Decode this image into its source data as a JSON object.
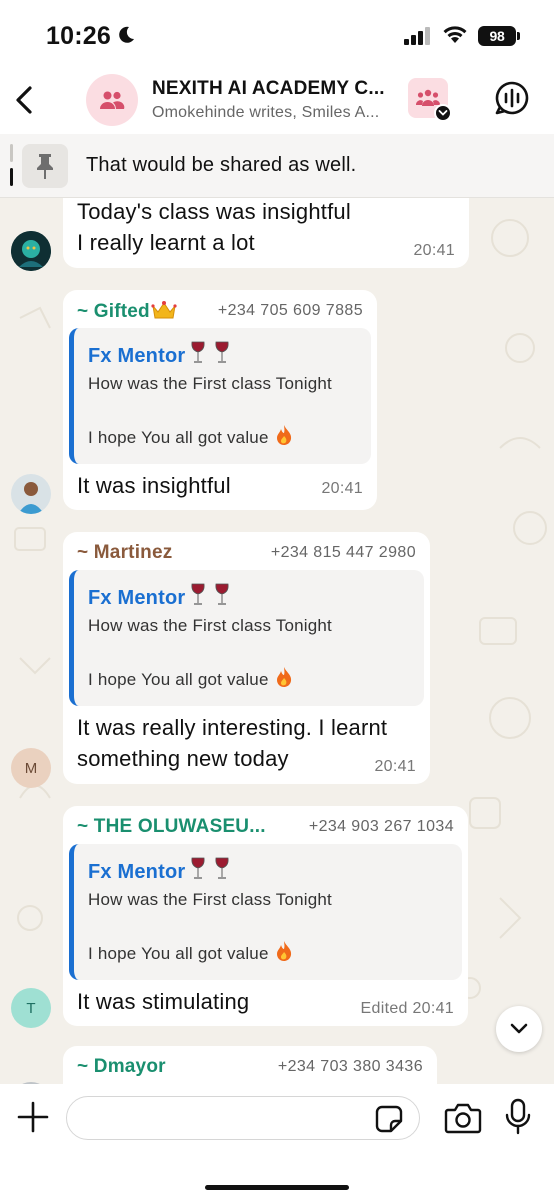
{
  "status_bar": {
    "time": "10:26",
    "battery": "98"
  },
  "header": {
    "title": "NEXITH AI ACADEMY C...",
    "subtitle": "Omokehinde writes, Smiles A..."
  },
  "pinned": {
    "text": "That would be shared as well."
  },
  "messages": [
    {
      "lines": [
        "Today's class was insightful",
        "I really learnt a lot"
      ],
      "time": "20:41"
    },
    {
      "sender": "~ Gifted",
      "sender_emoji": "crown-emoji",
      "phone": "+234 705 609 7885",
      "quote": {
        "author": "Fx Mentor",
        "line1": "How was the First class Tonight",
        "line2": "I hope You all got value"
      },
      "text": "It was insightful",
      "time": "20:41"
    },
    {
      "sender": "~ Martinez",
      "phone": "+234 815 447 2980",
      "avatar_letter": "M",
      "quote": {
        "author": "Fx Mentor",
        "line1": "How was the First class Tonight",
        "line2": "I hope You all got value"
      },
      "lines": [
        "It was really interesting. I learnt",
        "something new today"
      ],
      "time": "20:41"
    },
    {
      "sender": "~ THE OLUWASEU...",
      "phone": "+234 903 267 1034",
      "avatar_letter": "T",
      "quote": {
        "author": "Fx Mentor",
        "line1": "How was the First class Tonight",
        "line2": "I hope You all got value"
      },
      "text": "It was stimulating",
      "time": "Edited 20:41"
    },
    {
      "sender": "~ Dmayor",
      "phone": "+234 703 380 3436"
    }
  ],
  "colors": {
    "gifted": "#1a8f6f",
    "martinez": "#8a5a3c",
    "oluwaseu": "#1a8f6f",
    "dmayor": "#1a8f6f",
    "quote_accent": "#1a6fd1",
    "pin_accent": "#111111",
    "chat_bg": "#f3f0ea",
    "group_avatar_bg": "#fbdde2",
    "group_avatar_icon": "#d64f6b"
  },
  "compose": {
    "placeholder": ""
  }
}
